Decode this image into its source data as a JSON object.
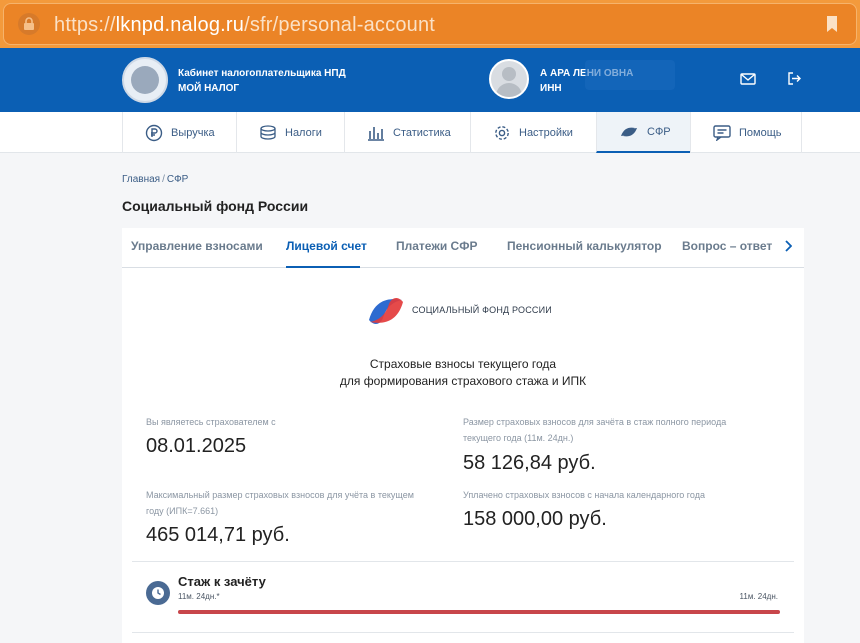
{
  "browser": {
    "url_scheme": "https://",
    "url_host": "lknpd.nalog.ru",
    "url_path": "/sfr/personal-account"
  },
  "header": {
    "brand_line1": "Кабинет налогоплательщика НПД",
    "brand_line2": "МОЙ НАЛОГ",
    "user_name": "А          АРА  ЛЕНИ              ОВНА",
    "user_inn": "ИНН"
  },
  "nav": {
    "items": [
      {
        "label": "Выручка",
        "icon": "ruble-icon"
      },
      {
        "label": "Налоги",
        "icon": "coins-icon"
      },
      {
        "label": "Статистика",
        "icon": "bar-chart-icon"
      },
      {
        "label": "Настройки",
        "icon": "gear-icon"
      },
      {
        "label": "СФР",
        "icon": "sfr-icon",
        "active": true
      },
      {
        "label": "Помощь",
        "icon": "help-icon"
      }
    ]
  },
  "breadcrumb": {
    "home": "Главная",
    "separator": "/",
    "current": "СФР"
  },
  "page_title": "Социальный фонд России",
  "tabs": [
    {
      "label": "Управление взносами"
    },
    {
      "label": "Лицевой счет",
      "active": true
    },
    {
      "label": "Платежи СФР"
    },
    {
      "label": "Пенсионный калькулятор"
    },
    {
      "label": "Вопрос – ответ"
    }
  ],
  "sfr": {
    "logo_text": "СОЦИАЛЬНЫЙ ФОНД РОССИИ",
    "subtitle_line1": "Страховые взносы текущего года",
    "subtitle_line2": "для формирования страхового стажа и ИПК"
  },
  "stats": {
    "insured_since_label": "Вы являетесь страхователем с",
    "insured_since_value": "08.01.2025",
    "full_period_label_1": "Размер страховых взносов для зачёта в стаж полного периода",
    "full_period_label_2": "текущего года (11м. 24дн.)",
    "full_period_value": "58 126,84 руб.",
    "max_label_1": "Максимальный размер страховых взносов для учёта в текущем",
    "max_label_2": "году (ИПК=7.661)",
    "max_value": "465 014,71 руб.",
    "paid_label": "Уплачено страховых взносов с начала календарного года",
    "paid_value": "158 000,00 руб."
  },
  "stazh": {
    "title": "Стаж к зачёту",
    "current": "11м. 24дн.*",
    "total": "11м. 24дн.",
    "progress_fraction": 1.0
  },
  "colors": {
    "header_blue": "#0b5fb4",
    "urlbar_orange": "#eb8426",
    "progress_red": "#c8464b"
  }
}
